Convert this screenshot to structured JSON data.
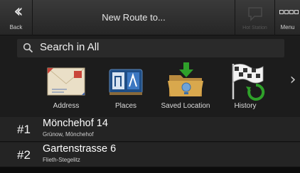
{
  "topbar": {
    "back_label": "Back",
    "back_icon": "double-chevron-left-icon",
    "title": "New Route to...",
    "hotstation_label": "Hot Station",
    "menu_label": "Menu",
    "menu_icon": "grid-icon"
  },
  "search": {
    "placeholder": "Search in All",
    "icon": "search-icon"
  },
  "categories": [
    {
      "label": "Address",
      "icon": "envelope-icon"
    },
    {
      "label": "Places",
      "icon": "places-icon"
    },
    {
      "label": "Saved Location",
      "icon": "folder-download-icon"
    },
    {
      "label": "History",
      "icon": "checkered-flag-icon"
    }
  ],
  "more_icon": "chevron-right-icon",
  "history": [
    {
      "index": "1",
      "name": "Mönchehof 14",
      "detail": "Grünow, Mönchehof"
    },
    {
      "index": "2",
      "name": "Gartenstrasse 6",
      "detail": "Flieth-Stegelitz"
    }
  ],
  "colors": {
    "background": "#1c1c1c",
    "topbar": "#2e2e2e",
    "text": "#ffffff",
    "accent_green": "#2fa12a"
  }
}
